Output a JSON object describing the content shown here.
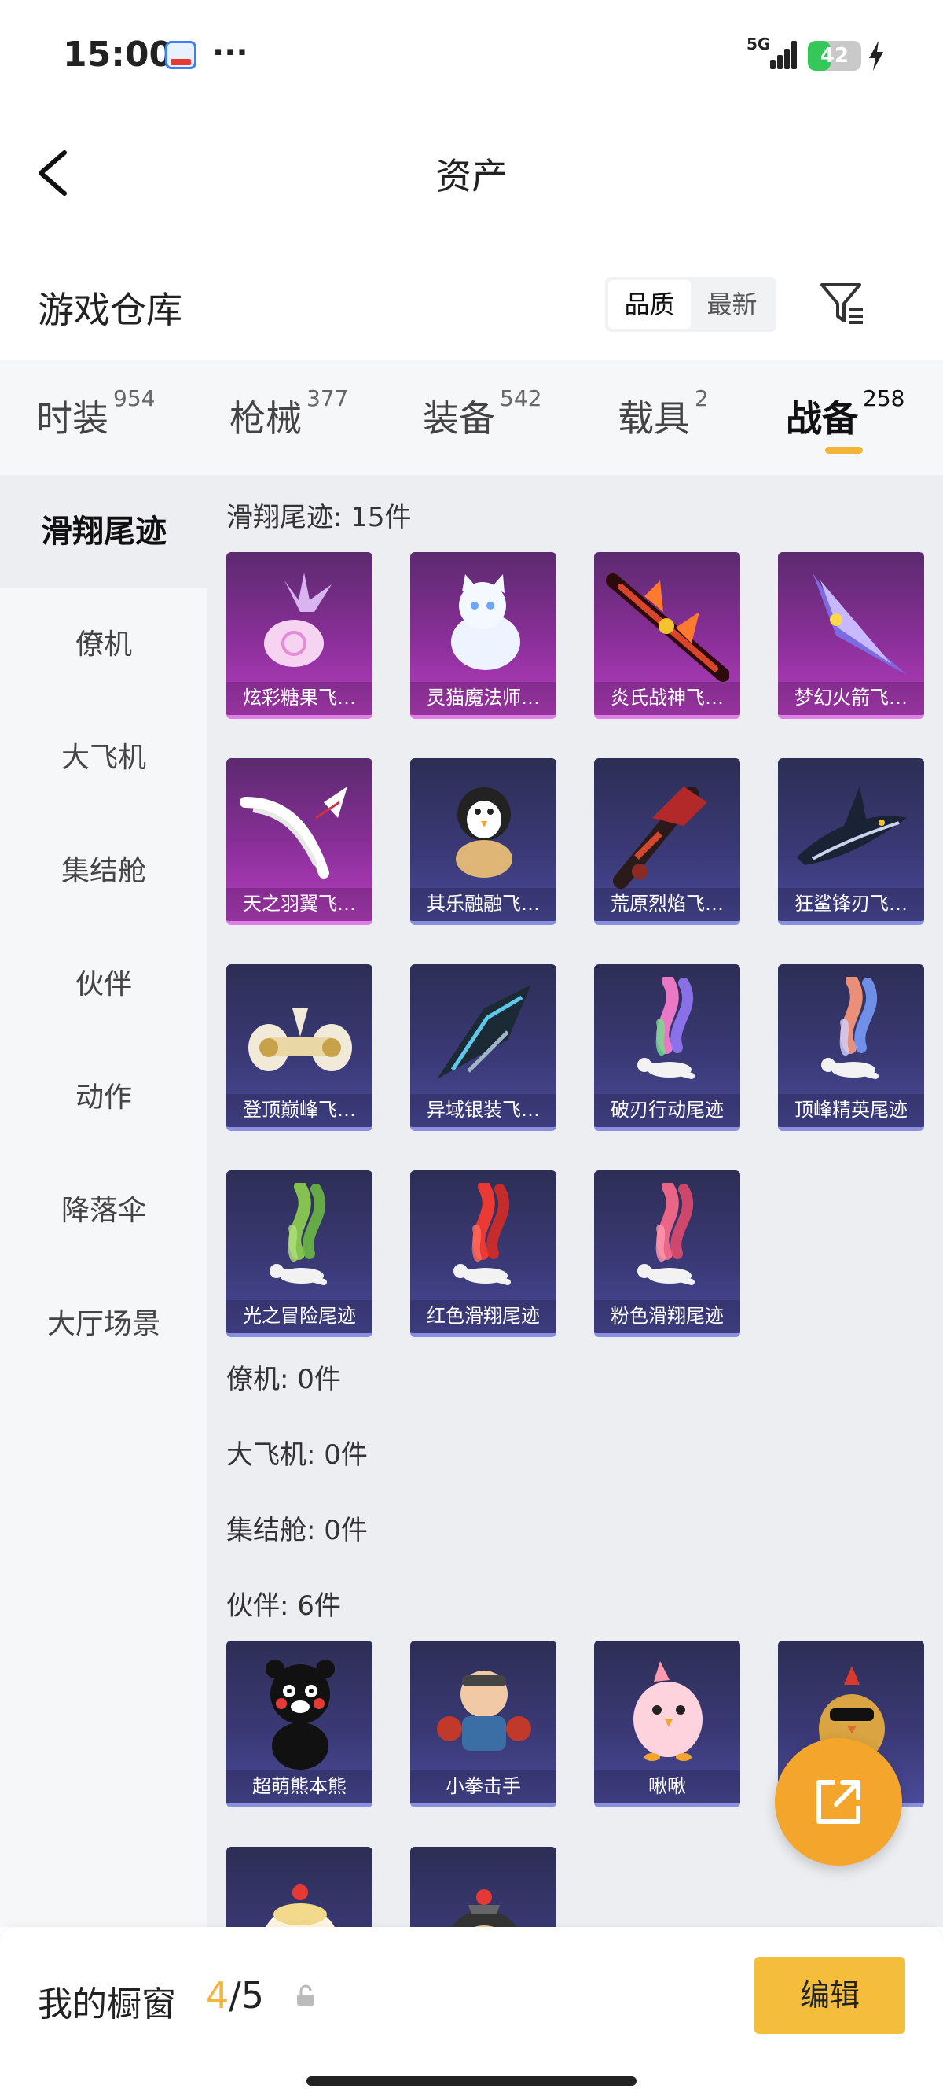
{
  "status_bar": {
    "time": "15:00",
    "more": "···",
    "network": "5G",
    "battery": "42",
    "battery_level": 0.42
  },
  "nav": {
    "title": "资产"
  },
  "warehouse": {
    "title": "游戏仓库",
    "sort_options": [
      "品质",
      "最新"
    ],
    "sort_selected": "品质"
  },
  "tabs": [
    {
      "label": "时装",
      "count": "954"
    },
    {
      "label": "枪械",
      "count": "377"
    },
    {
      "label": "装备",
      "count": "542"
    },
    {
      "label": "载具",
      "count": "2"
    },
    {
      "label": "战备",
      "count": "258",
      "active": true
    }
  ],
  "sidebar": {
    "items": [
      "滑翔尾迹",
      "僚机",
      "大飞机",
      "集结舱",
      "伙伴",
      "动作",
      "降落伞",
      "大厅场景"
    ],
    "active": "滑翔尾迹"
  },
  "sections": {
    "glide": {
      "title": "滑翔尾迹: 15件",
      "items": [
        {
          "name": "炫彩糖果飞…",
          "rarity": "purple",
          "icon": "candy-glider-icon"
        },
        {
          "name": "灵猫魔法师…",
          "rarity": "purple",
          "icon": "cat-glider-icon"
        },
        {
          "name": "炎氏战神飞…",
          "rarity": "purple",
          "icon": "flame-glider-icon"
        },
        {
          "name": "梦幻火箭飞…",
          "rarity": "purple",
          "icon": "rocket-glider-icon"
        },
        {
          "name": "天之羽翼飞…",
          "rarity": "purple",
          "icon": "wing-glider-icon"
        },
        {
          "name": "其乐融融飞…",
          "rarity": "blue",
          "icon": "penguin-glider-icon"
        },
        {
          "name": "荒原烈焰飞…",
          "rarity": "blue",
          "icon": "wasteland-glider-icon"
        },
        {
          "name": "狂鲨锋刃飞…",
          "rarity": "blue",
          "icon": "shark-glider-icon"
        },
        {
          "name": "登顶巅峰飞…",
          "rarity": "blue",
          "icon": "summit-glider-icon"
        },
        {
          "name": "异域银装飞…",
          "rarity": "blue",
          "icon": "silver-glider-icon"
        },
        {
          "name": "破刃行动尾迹",
          "rarity": "blue",
          "icon": "smoke-trail-icon",
          "colors": [
            "#ff7fd0",
            "#9a7bff",
            "#6fe08a"
          ]
        },
        {
          "name": "顶峰精英尾迹",
          "rarity": "blue",
          "icon": "smoke-trail-icon",
          "colors": [
            "#ff9a7a",
            "#7aa0ff",
            "#d0d0ff"
          ]
        },
        {
          "name": "光之冒险尾迹",
          "rarity": "blue",
          "icon": "smoke-trail-icon",
          "colors": [
            "#8fd14f",
            "#6fbf3f",
            "#b2e07a"
          ]
        },
        {
          "name": "红色滑翔尾迹",
          "rarity": "blue",
          "icon": "smoke-trail-icon",
          "colors": [
            "#ff3b30",
            "#e02a22",
            "#ff6b5e"
          ]
        },
        {
          "name": "粉色滑翔尾迹",
          "rarity": "blue",
          "icon": "smoke-trail-icon",
          "colors": [
            "#ff6b8a",
            "#e94b6f",
            "#ff9ab0"
          ]
        }
      ]
    },
    "wingman": {
      "title": "僚机: 0件"
    },
    "plane": {
      "title": "大飞机: 0件"
    },
    "capsule": {
      "title": "集结舱: 0件"
    },
    "partner": {
      "title": "伙伴: 6件",
      "items": [
        {
          "name": "超萌熊本熊",
          "rarity": "blue",
          "icon": "kumamon-icon"
        },
        {
          "name": "小拳击手",
          "rarity": "blue",
          "icon": "boxer-icon"
        },
        {
          "name": "啾啾",
          "rarity": "blue",
          "icon": "pink-bird-icon"
        },
        {
          "name": "",
          "rarity": "blue",
          "icon": "chick-sunglasses-icon"
        },
        {
          "name": "",
          "rarity": "blue",
          "icon": "white-chick-icon"
        },
        {
          "name": "",
          "rarity": "blue",
          "icon": "helmet-bear-icon"
        }
      ]
    }
  },
  "showcase": {
    "title": "我的橱窗",
    "current": "4",
    "total": "/5",
    "edit_label": "编辑"
  },
  "colors": {
    "accent": "#f2b53a",
    "fab": "#f4a62c",
    "purple_card": "#8b2f9a",
    "blue_card": "#3b3a78"
  }
}
